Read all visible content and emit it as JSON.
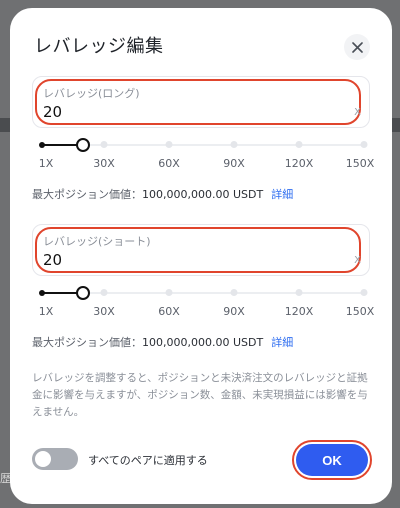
{
  "background": {
    "edge_text": "歴"
  },
  "modal": {
    "title": "レバレッジ編集",
    "close_icon": "close-icon"
  },
  "long": {
    "label": "レバレッジ(ロング)",
    "value": "20",
    "unit": "X",
    "slider_level": 20,
    "ticks": [
      "1X",
      "30X",
      "60X",
      "90X",
      "120X",
      "150X"
    ],
    "max_label": "最大ポジション価値：",
    "max_value": "100,000,000.00 USDT",
    "detail_link": "詳細"
  },
  "short": {
    "label": "レバレッジ(ショート)",
    "value": "20",
    "unit": "X",
    "slider_level": 20,
    "ticks": [
      "1X",
      "30X",
      "60X",
      "90X",
      "120X",
      "150X"
    ],
    "max_label": "最大ポジション価値：",
    "max_value": "100,000,000.00 USDT",
    "detail_link": "詳細"
  },
  "notice": "レバレッジを調整すると、ポジションと未決済注文のレバレッジと証拠金に影響を与えますが、ポジション数、金額、未実現損益には影響を与えません。",
  "apply_all": {
    "label": "すべてのペアに適用する",
    "on": false
  },
  "ok_button": "OK",
  "colors": {
    "accent": "#2f5cf0",
    "highlight": "#e0452d",
    "link": "#2f6ef0"
  }
}
